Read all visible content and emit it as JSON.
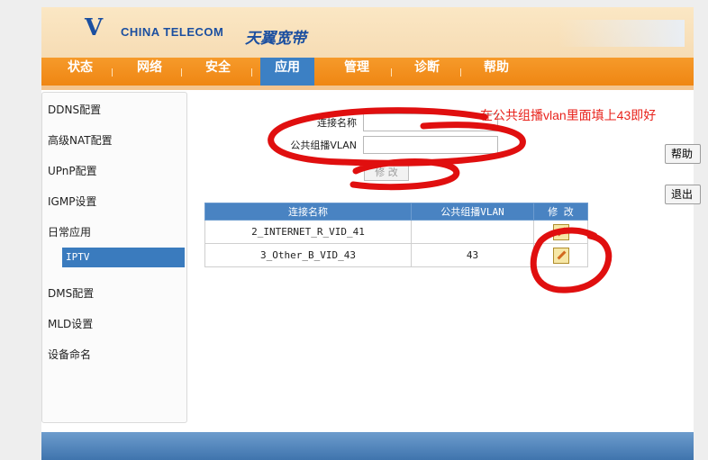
{
  "header": {
    "logo_mark": "V",
    "brand_en": "CHINA TELECOM",
    "brand_cn": "天翼宽带"
  },
  "nav": {
    "items": [
      {
        "label": "状态"
      },
      {
        "label": "网络"
      },
      {
        "label": "安全"
      },
      {
        "label": "应用",
        "active": true
      },
      {
        "label": "管理"
      },
      {
        "label": "诊断"
      },
      {
        "label": "帮助"
      }
    ]
  },
  "sidebar": {
    "items": [
      "DDNS配置",
      "高级NAT配置",
      "UPnP配置",
      "IGMP设置",
      "日常应用",
      "DMS配置",
      "MLD设置",
      "设备命名"
    ],
    "selected_sub": "IPTV"
  },
  "form": {
    "conn_name_label": "连接名称",
    "vlan_label": "公共组播VLAN",
    "conn_name_value": "",
    "vlan_value": "",
    "modify_button": "修 改"
  },
  "right_buttons": {
    "help": "帮助",
    "logout": "退出"
  },
  "table": {
    "headers": [
      "连接名称",
      "公共组播VLAN",
      "修 改"
    ],
    "rows": [
      {
        "name": "2_INTERNET_R_VID_41",
        "vlan": ""
      },
      {
        "name": "3_Other_B_VID_43",
        "vlan": "43"
      }
    ]
  },
  "annotation": {
    "text": "在公共组播vlan里面填上43即好",
    "color": "#e8231c"
  },
  "colors": {
    "nav_orange": "#f0891a",
    "nav_active": "#3c80c4",
    "brand_blue": "#1b4fa0"
  }
}
